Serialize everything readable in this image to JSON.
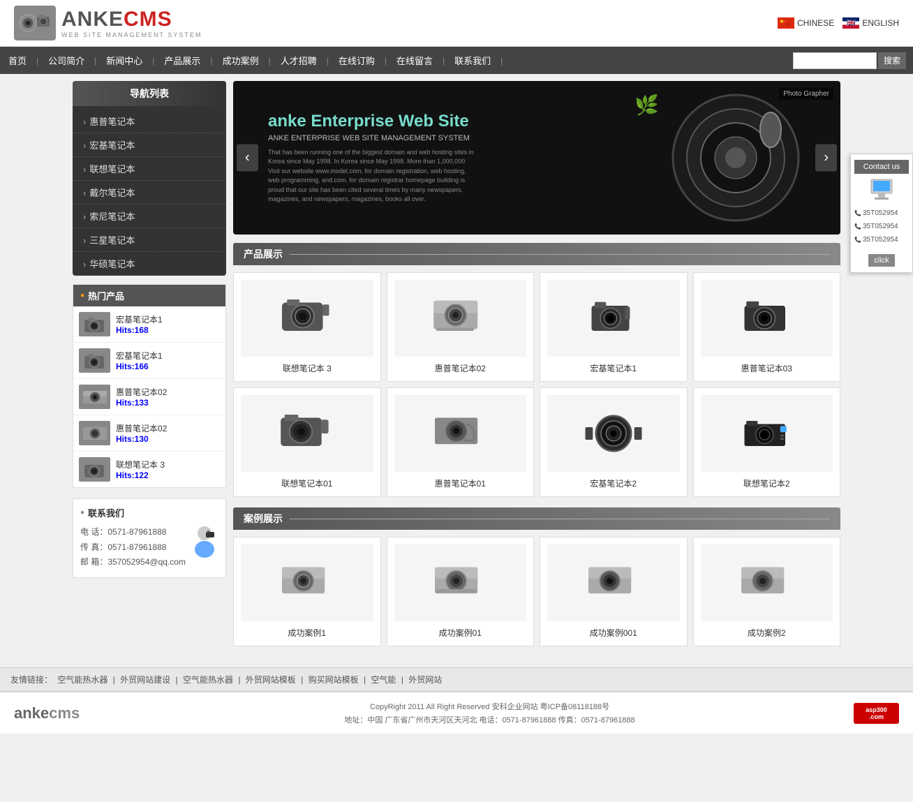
{
  "header": {
    "logo_title": "ANKECMS",
    "logo_anke": "ANKE",
    "logo_cms": "CMS",
    "logo_subtitle": "WEB SITE MANAGEMENT SYSTEM",
    "lang_chinese": "CHINESE",
    "lang_english": "ENGLISH"
  },
  "nav": {
    "items": [
      "首页",
      "公司简介",
      "新闻中心",
      "产品展示",
      "成功案例",
      "人才招聘",
      "在线订购",
      "在线留言",
      "联系我们"
    ],
    "search_placeholder": "",
    "search_button": "搜索"
  },
  "sidebar_nav": {
    "title": "导航列表",
    "items": [
      "惠普笔记本",
      "宏基笔记本",
      "联想笔记本",
      "戴尔笔记本",
      "索尼笔记本",
      "三星笔记本",
      "华硕笔记本"
    ]
  },
  "hot_products": {
    "title": "热门产品",
    "items": [
      {
        "name": "宏基笔记本1",
        "hits": "Hits:168"
      },
      {
        "name": "宏基笔记本1",
        "hits": "Hits:166"
      },
      {
        "name": "惠普笔记本02",
        "hits": "Hits:133"
      },
      {
        "name": "惠普笔记本02",
        "hits": "Hits:130"
      },
      {
        "name": "联想笔记本 3",
        "hits": "Hits:122"
      }
    ]
  },
  "contact": {
    "title": "联系我们",
    "phone_label": "电 话：",
    "phone": "0571-87961888",
    "fax_label": "传 真：",
    "fax": "0571-87961888",
    "email_label": "邮 箱：",
    "email": "357052954@qq.com"
  },
  "banner": {
    "title": "anke  Enterprise Web Site",
    "subtitle": "ANKE ENTERPRISE WEB SITE MANAGEMENT SYSTEM",
    "desc": "That has been running one of the biggest domain and web hosting sites in Korea since May 1998. In Korea since May 1998. More than 1,000,000 Visit our website www.model.com, for domain registration, web hosting, web programming, and.com. for domain registrar homepage building is proud that our site has been cited several times by many newspapers, magazines, and newspapers, magazines, books all over."
  },
  "products": {
    "section_title": "产品展示",
    "items": [
      {
        "name": "联想笔记本 3",
        "icon": "📷"
      },
      {
        "name": "惠普笔记本02",
        "icon": "📸"
      },
      {
        "name": "宏基笔记本1",
        "icon": "📷"
      },
      {
        "name": "惠普笔记本03",
        "icon": "📷"
      },
      {
        "name": "联想笔记本01",
        "icon": "📷"
      },
      {
        "name": "惠普笔记本01",
        "icon": "📸"
      },
      {
        "name": "宏基笔记本2",
        "icon": "📷"
      },
      {
        "name": "联想笔记本2",
        "icon": "📷"
      }
    ]
  },
  "cases": {
    "section_title": "案例展示",
    "items": [
      {
        "name": "成功案例1",
        "icon": "📸"
      },
      {
        "name": "成功案例01",
        "icon": "📸"
      },
      {
        "name": "成功案例001",
        "icon": "📸"
      },
      {
        "name": "成功案例2",
        "icon": "📸"
      }
    ]
  },
  "footer_links": {
    "label": "友情链接：",
    "items": [
      "空气能热水器",
      "外贸网站建设",
      "空气能热水器",
      "外贸网站模板",
      "购买网站模板",
      "空气能",
      "外贸网站"
    ]
  },
  "footer": {
    "logo": "ankecms",
    "copyright": "CopyRight 2011 All Right Reserved 安科企业网站 粤ICP备08118188号",
    "address": "地址：中国 广东省广州市天河区天河北 电话：0571-87961888 传真：0571-87961888"
  },
  "contact_float": {
    "title": "Contact us",
    "numbers": [
      "35T052954",
      "35T052954",
      "35T052954"
    ],
    "click": "click"
  }
}
